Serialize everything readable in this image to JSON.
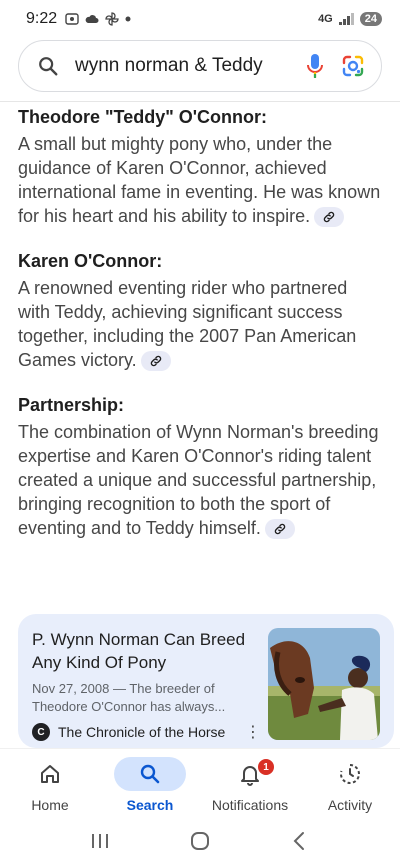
{
  "status_bar": {
    "time": "9:22",
    "network": "4G",
    "battery": "24"
  },
  "search": {
    "query": "wynn norman & Teddy"
  },
  "sections": [
    {
      "heading": "Theodore \"Teddy\" O'Connor:",
      "body": "A small but mighty pony who, under the guidance of Karen O'Connor, achieved international fame in eventing. He was known for his heart and his ability to inspire."
    },
    {
      "heading": "Karen O'Connor:",
      "body": "A renowned eventing rider who partnered with Teddy, achieving significant success together, including the 2007 Pan American Games victory."
    },
    {
      "heading": "Partnership:",
      "body": "The combination of Wynn Norman's breeding expertise and Karen O'Connor's riding talent created a unique and successful partnership, bringing recognition to both the sport of eventing and to Teddy himself."
    }
  ],
  "result_card": {
    "title": "P. Wynn Norman Can Breed Any Kind Of Pony",
    "snippet": "Nov 27, 2008 — The breeder of Theodore O'Connor has always...",
    "source": "The Chronicle of the Horse"
  },
  "bottom_nav": {
    "items": [
      {
        "label": "Home"
      },
      {
        "label": "Search"
      },
      {
        "label": "Notifications",
        "badge": "1"
      },
      {
        "label": "Activity"
      }
    ]
  }
}
